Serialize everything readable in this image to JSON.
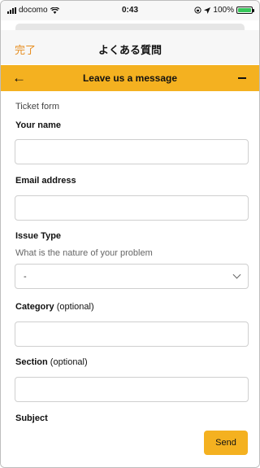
{
  "status_bar": {
    "carrier": "docomo",
    "time": "0:43",
    "battery": "100%",
    "battery_fill": 1.0,
    "icons": [
      "signal-icon",
      "wifi-icon",
      "rotation-lock-icon",
      "location-icon",
      "battery-charging-icon"
    ]
  },
  "header": {
    "done_label": "完了",
    "title": "よくある質問"
  },
  "widget_bar": {
    "back_icon": "arrow-left-icon",
    "title": "Leave us a message",
    "minimize_icon": "minus-icon"
  },
  "form": {
    "heading": "Ticket form",
    "name_label": "Your name",
    "name_value": "",
    "email_label": "Email address",
    "email_value": "",
    "issue_label": "Issue Type",
    "issue_hint": "What is the nature of your problem",
    "issue_selected": "-",
    "category_label": "Category",
    "category_optional": "(optional)",
    "category_value": "",
    "section_label": "Section",
    "section_optional": "(optional)",
    "section_value": "",
    "subject_label": "Subject"
  },
  "footer": {
    "send_label": "Send"
  },
  "colors": {
    "accent": "#f4b120",
    "done_text": "#e78c1d"
  }
}
